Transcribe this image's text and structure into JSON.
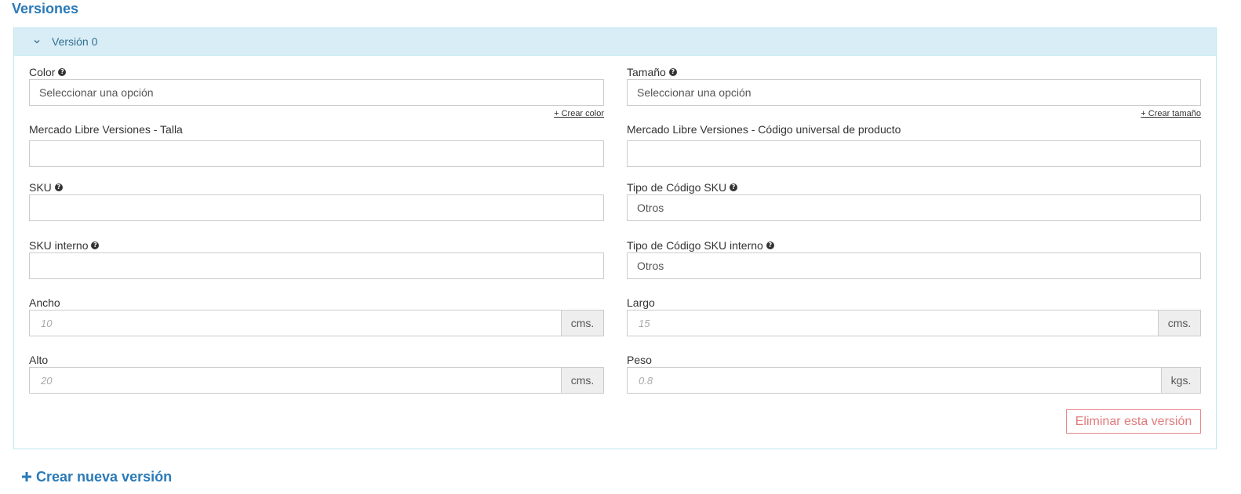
{
  "section": {
    "title": "Versiones"
  },
  "version": {
    "header_label": "Versión 0"
  },
  "fields": {
    "color": {
      "label": "Color",
      "value": "Seleccionar una opción",
      "create_link": "+ Crear color"
    },
    "tamano": {
      "label": "Tamaño",
      "value": "Seleccionar una opción",
      "create_link": "+ Crear tamaño"
    },
    "ml_talla": {
      "label": "Mercado Libre Versiones - Talla",
      "value": ""
    },
    "ml_codigo": {
      "label": "Mercado Libre Versiones - Código universal de producto",
      "value": ""
    },
    "sku": {
      "label": "SKU",
      "value": ""
    },
    "tipo_sku": {
      "label": "Tipo de Código SKU",
      "value": "Otros"
    },
    "sku_interno": {
      "label": "SKU interno",
      "value": ""
    },
    "tipo_sku_interno": {
      "label": "Tipo de Código SKU interno",
      "value": "Otros"
    },
    "ancho": {
      "label": "Ancho",
      "placeholder": "10",
      "unit": "cms."
    },
    "largo": {
      "label": "Largo",
      "placeholder": "15",
      "unit": "cms."
    },
    "alto": {
      "label": "Alto",
      "placeholder": "20",
      "unit": "cms."
    },
    "peso": {
      "label": "Peso",
      "placeholder": "0.8",
      "unit": "kgs."
    }
  },
  "actions": {
    "delete_label": "Eliminar esta versión",
    "create_label": "Crear nueva versión"
  },
  "icons": {
    "help": "question-circle-icon",
    "chevron": "chevron-down-icon",
    "plus": "plus-icon"
  },
  "colors": {
    "accent": "#2a7ab8",
    "panel_header_bg": "#d9edf7",
    "danger": "#e07a7c"
  }
}
